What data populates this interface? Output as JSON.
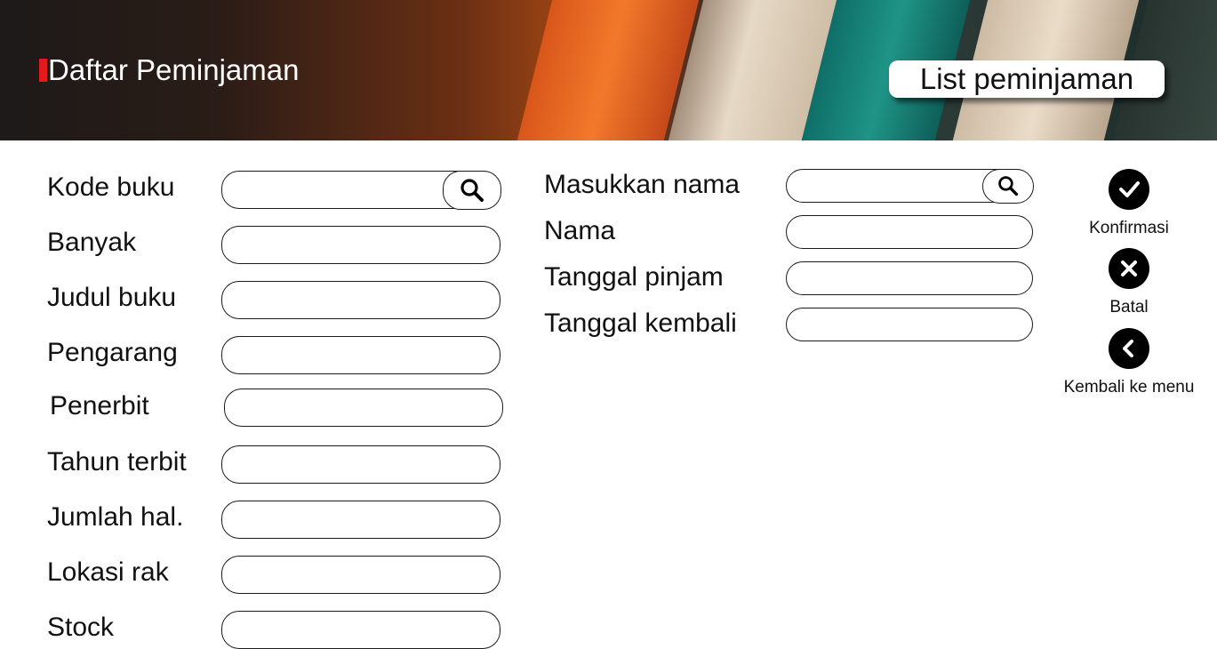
{
  "header": {
    "title": "Daftar Peminjaman",
    "list_button": "List peminjaman"
  },
  "book_form": {
    "fields": [
      {
        "label": "Kode buku",
        "value": "",
        "has_search": true
      },
      {
        "label": "Banyak",
        "value": ""
      },
      {
        "label": "Judul buku",
        "value": ""
      },
      {
        "label": "Pengarang",
        "value": ""
      },
      {
        "label": "Penerbit",
        "value": ""
      },
      {
        "label": "Tahun terbit",
        "value": ""
      },
      {
        "label": "Jumlah hal.",
        "value": ""
      },
      {
        "label": "Lokasi rak",
        "value": ""
      },
      {
        "label": "Stock",
        "value": ""
      }
    ]
  },
  "borrower_form": {
    "fields": [
      {
        "label": "Masukkan nama",
        "value": "",
        "has_search": true
      },
      {
        "label": "Nama",
        "value": ""
      },
      {
        "label": "Tanggal pinjam",
        "value": ""
      },
      {
        "label": "Tanggal kembali",
        "value": ""
      }
    ]
  },
  "actions": {
    "confirm": {
      "label": "Konfirmasi",
      "icon": "check-icon"
    },
    "cancel": {
      "label": "Batal",
      "icon": "close-icon"
    },
    "back": {
      "label": "Kembali ke menu",
      "icon": "chevron-left-icon"
    }
  },
  "colors": {
    "brand_mark": "#e3191b",
    "icon_fill": "#000000"
  }
}
